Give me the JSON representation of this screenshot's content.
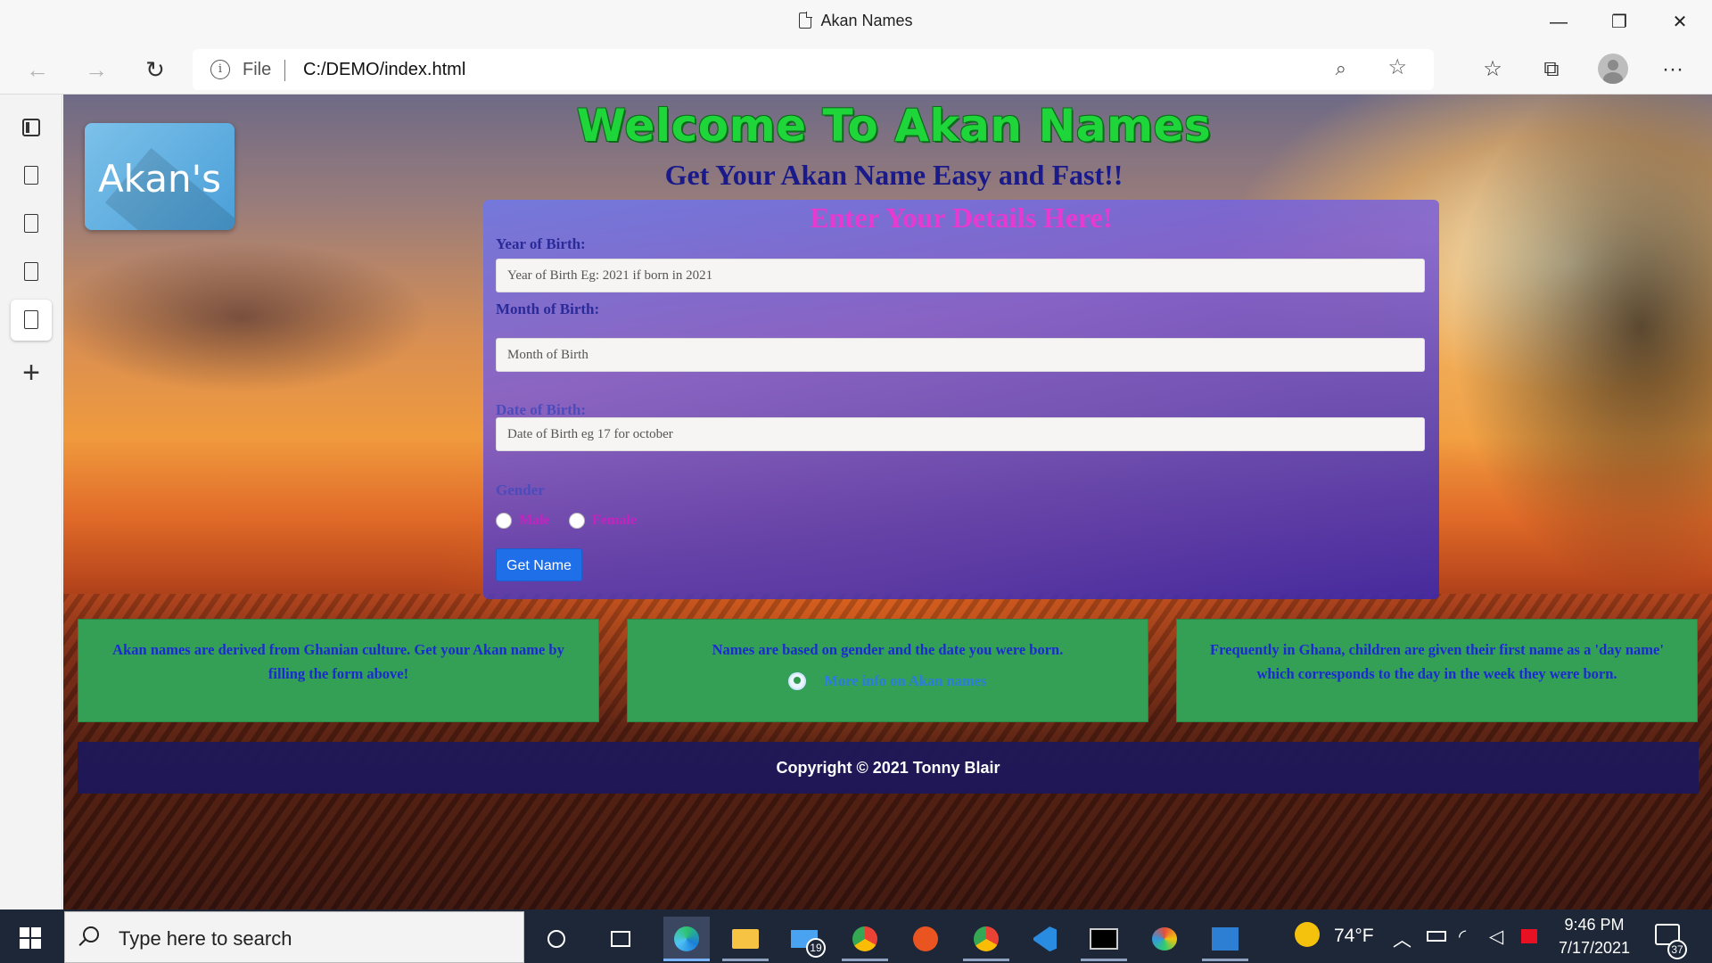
{
  "window": {
    "tab_title": "Akan Names",
    "controls": {
      "minimize": "—",
      "restore": "❐",
      "close": "✕"
    }
  },
  "browser": {
    "back": "←",
    "forward": "→",
    "reload": "↻",
    "info_glyph": "i",
    "file_label": "File",
    "url": "C:/DEMO/index.html",
    "zoom_glyph": "⌕",
    "add_favorite_glyph": "☆",
    "favorites_glyph": "☆",
    "collections_glyph": "⧉",
    "more_glyph": "···"
  },
  "sidebar": {
    "add_tab": "+"
  },
  "page": {
    "logo_text": "Akan's",
    "title": "Welcome To Akan Names",
    "subtitle": "Get Your Akan Name Easy and Fast!!",
    "form": {
      "heading": "Enter Your Details Here!",
      "year_label": "Year of Birth:",
      "year_placeholder": "Year of Birth Eg: 2021 if born in 2021",
      "month_label": "Month of Birth:",
      "month_placeholder": "Month of Birth",
      "date_label": "Date of Birth:",
      "date_placeholder": "Date of Birth eg 17 for october",
      "gender_label": "Gender",
      "male_label": "Male",
      "female_label": "Female",
      "submit_label": "Get Name"
    },
    "cards": [
      {
        "text": "Akan names are derived from Ghanian culture. Get your Akan name by filling the form above!"
      },
      {
        "text": "Names are based on gender and the date you were born.",
        "link": "More info on Akan names"
      },
      {
        "text": "Frequently in Ghana, children are given their first name as a 'day name' which corresponds to the day in the week they were born."
      }
    ],
    "footer": "Copyright © 2021 Tonny Blair"
  },
  "taskbar": {
    "search_placeholder": "Type here to search",
    "mail_badge": "19",
    "weather": "74°F",
    "time": "9:46 PM",
    "date": "7/17/2021",
    "notification_badge": "37"
  },
  "colors": {
    "title_green": "#1ed63a",
    "subtitle_navy": "#1a1a8a",
    "form_heading_magenta": "#e63ad0",
    "button_blue": "#1f6fe8",
    "card_green": "#33a055",
    "footer_navy": "#1c185c",
    "taskbar": "#1e2738"
  },
  "icons": {
    "tab": "page-icon",
    "sidebar": [
      "tab-actions-icon",
      "page-icon",
      "page-icon",
      "page-icon",
      "page-icon"
    ],
    "taskbar": [
      "cortana-icon",
      "task-view-icon",
      "edge-icon",
      "file-explorer-icon",
      "mail-icon",
      "chrome-icon",
      "ubuntu-icon",
      "chrome-profile-icon",
      "vscode-icon",
      "terminal-icon",
      "paint-icon",
      "photos-icon"
    ]
  }
}
